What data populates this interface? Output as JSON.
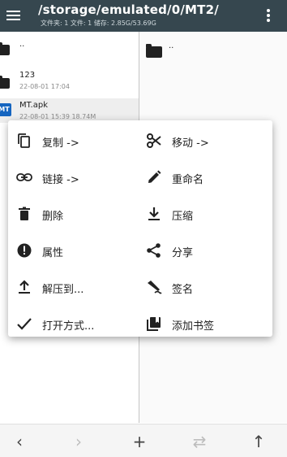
{
  "appbar": {
    "title": "/storage/emulated/0/MT2/",
    "subtitle": "文件夹: 1  文件: 1  储存: 2.85G/53.69G"
  },
  "left_pane": {
    "items": [
      {
        "name": "..",
        "meta": ""
      },
      {
        "name": "123",
        "meta": "22-08-01 17:04"
      },
      {
        "name": "MT.apk",
        "meta": "22-08-01 15:39  18.74M",
        "icon_text": "MT"
      }
    ]
  },
  "right_pane": {
    "items": [
      {
        "name": ".."
      }
    ]
  },
  "context_menu": {
    "items": [
      {
        "label": "复制 ->",
        "icon": "copy-icon"
      },
      {
        "label": "移动 ->",
        "icon": "scissors-icon"
      },
      {
        "label": "链接 ->",
        "icon": "link-icon"
      },
      {
        "label": "重命名",
        "icon": "pencil-icon"
      },
      {
        "label": "删除",
        "icon": "trash-icon"
      },
      {
        "label": "压缩",
        "icon": "download-icon"
      },
      {
        "label": "属性",
        "icon": "info-icon"
      },
      {
        "label": "分享",
        "icon": "share-icon"
      },
      {
        "label": "解压到...",
        "icon": "upload-icon"
      },
      {
        "label": "签名",
        "icon": "signature-icon"
      },
      {
        "label": "打开方式...",
        "icon": "check-icon"
      },
      {
        "label": "添加书签",
        "icon": "bookmark-icon"
      }
    ]
  },
  "bottom_bar": {
    "back": "‹",
    "forward": "›",
    "add": "+",
    "swap": "⇄",
    "up": "↑"
  },
  "colors": {
    "appbar": "#36474f",
    "menu_bg": "#ffffff",
    "text": "#222222"
  }
}
